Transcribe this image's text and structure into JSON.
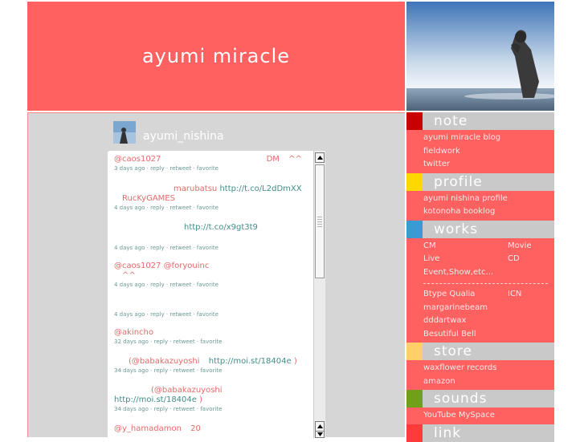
{
  "header": {
    "title": "ayumi miracle"
  },
  "feed": {
    "username": "ayumi_nishina",
    "tweets": [
      {
        "handle": "@caos1027",
        "extra": "DM",
        "extra2": "^^",
        "meta": "3 days ago · reply · retweet · favorite"
      },
      {
        "prefix": "marubatsu",
        "link": "http://t.co/L2dDmXX",
        "line2": "RucKyGAMES",
        "meta": "4 days ago · reply · retweet · favorite"
      },
      {
        "link": "http://t.co/x9gt3t9",
        "meta": "4 days ago · reply · retweet · favorite"
      },
      {
        "handle": "@caos1027",
        "handle2": "@foryouinc",
        "line2": "^^",
        "meta": "4 days ago · reply · retweet · favorite"
      },
      {
        "meta": "4 days ago · reply · retweet · favorite"
      },
      {
        "handle": "@akincho",
        "meta": "32 days ago · reply · retweet · favorite"
      },
      {
        "handle": "(@babakazuyoshi",
        "link": "http://moi.st/18404e",
        "close": ")",
        "meta": "34 days ago · reply · retweet · favorite"
      },
      {
        "handle": "(@babakazuyoshi",
        "link": "http://moi.st/18404e",
        "close": ")",
        "meta": "34 days ago · reply · retweet · favorite"
      },
      {
        "handle": "@y_hamadamon",
        "extra": "20"
      }
    ]
  },
  "sidebar": {
    "note": {
      "title": "note",
      "items": [
        "ayumi miracle blog",
        "fieldwork",
        "twitter"
      ]
    },
    "profile": {
      "title": "profile",
      "items": [
        "ayumi nishina profile",
        "kotonoha  booklog"
      ]
    },
    "works": {
      "title": "works",
      "row1": [
        "CM",
        "Movie"
      ],
      "row2": [
        "Live",
        "CD"
      ],
      "row3": "Event,Show,etc...",
      "row4": [
        "Btype Qualia",
        "ICN"
      ],
      "items": [
        "margarinebeam",
        "dddartwax",
        "Besutiful Bell"
      ]
    },
    "store": {
      "title": "store",
      "items": [
        "waxflower records",
        "amazon"
      ]
    },
    "sounds": {
      "title": "sounds",
      "items": [
        "YouTube  MySpace"
      ]
    },
    "link": {
      "title": "link"
    }
  },
  "colors": {
    "brand": "#ff6060",
    "note": "#c80000",
    "profile": "#ffd800",
    "works": "#3a9ad4",
    "store": "#ffcf6a",
    "sounds": "#6fa01a",
    "link": "#ff3a3a"
  }
}
